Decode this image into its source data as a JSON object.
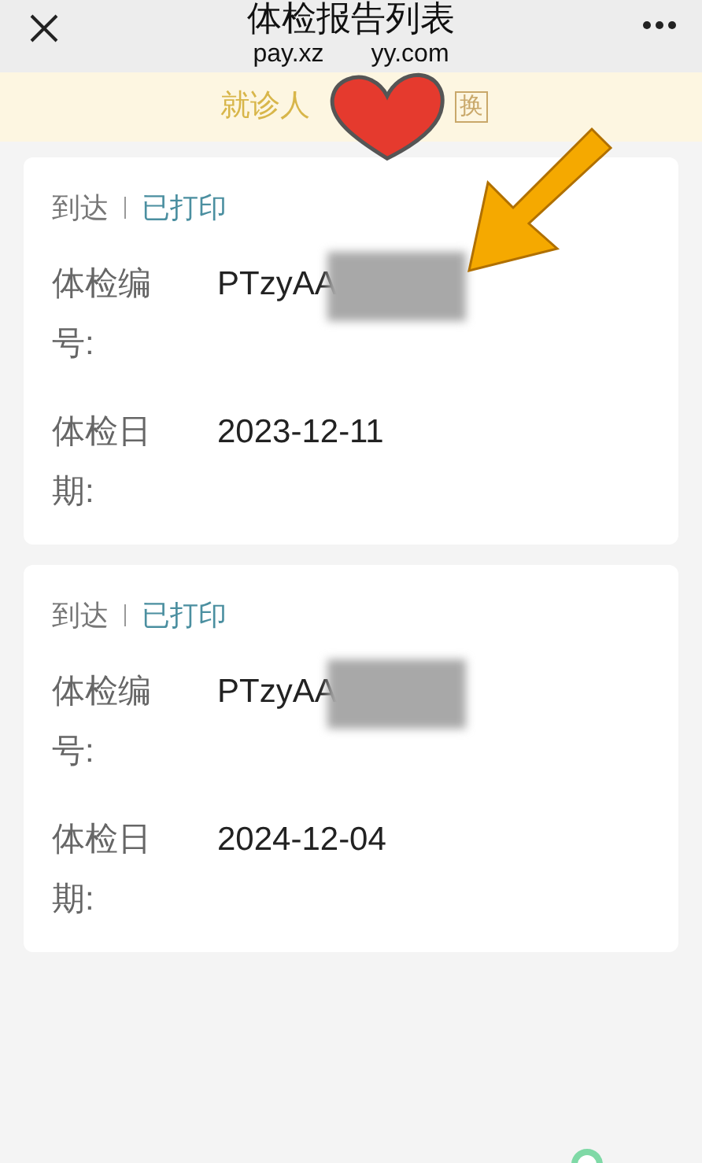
{
  "header": {
    "title": "体检报告列表",
    "url_parts": [
      "pay.xz",
      "yy.com"
    ]
  },
  "patient_bar": {
    "label": "就诊人",
    "switch_label": "换"
  },
  "reports": [
    {
      "status": "到达",
      "print_status": "已打印",
      "id_label": "体检编号:",
      "id_value": "PTzyAA",
      "date_label": "体检日期:",
      "date_value": "2023-12-11"
    },
    {
      "status": "到达",
      "print_status": "已打印",
      "id_label": "体检编号:",
      "id_value": "PTzyAA",
      "date_label": "体检日期:",
      "date_value": "2024-12-04"
    }
  ]
}
